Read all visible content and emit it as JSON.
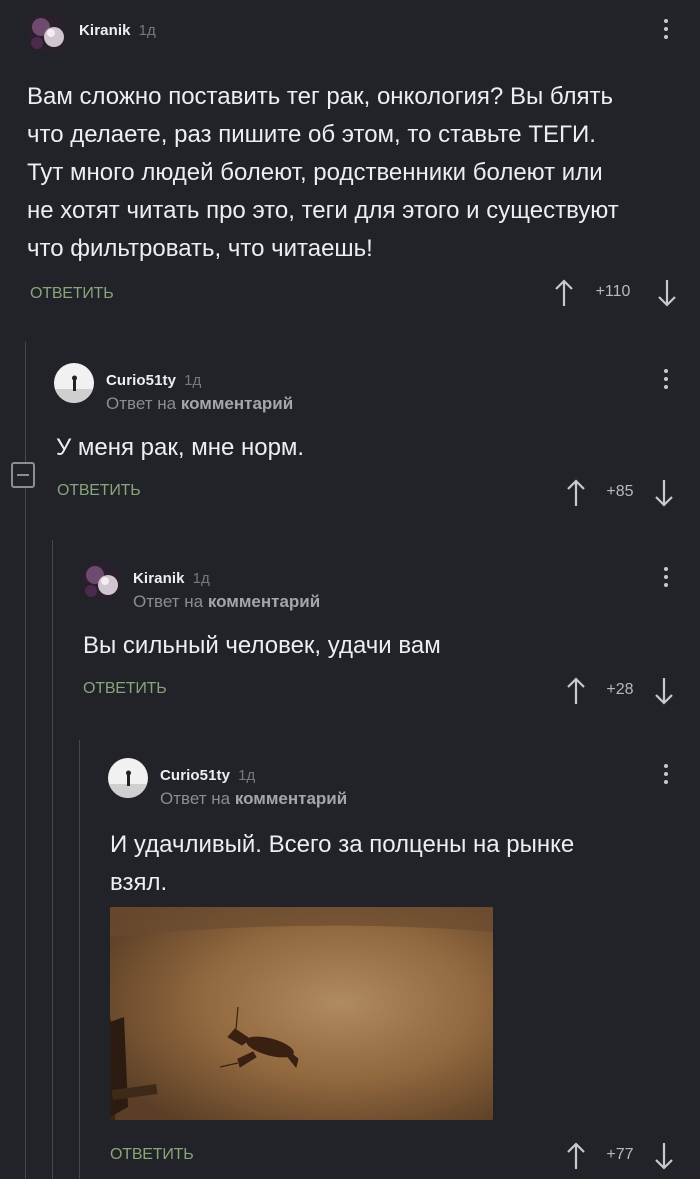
{
  "comments": [
    {
      "author": "Kiranik",
      "time": "1д",
      "text": "Вам сложно поставить тег рак, онкология? Вы блять что делаете, раз пишите об этом, то ставьте ТЕГИ. Тут много людей болеют, родственники болеют или не хотят читать про это, теги для этого и существуют что фильтровать, что читаешь!",
      "reply_label": "ОТВЕТИТЬ",
      "rating": "+110"
    },
    {
      "author": "Curio51ty",
      "time": "1д",
      "reply_to_prefix": "Ответ на",
      "reply_to_target": "комментарий",
      "text": "У меня рак, мне норм.",
      "reply_label": "ОТВЕТИТЬ",
      "rating": "+85"
    },
    {
      "author": "Kiranik",
      "time": "1д",
      "reply_to_prefix": "Ответ на",
      "reply_to_target": "комментарий",
      "text": "Вы сильный человек, удачи вам",
      "reply_label": "ОТВЕТИТЬ",
      "rating": "+28"
    },
    {
      "author": "Curio51ty",
      "time": "1д",
      "reply_to_prefix": "Ответ на",
      "reply_to_target": "комментарий",
      "text_line1": "И удачливый. Всего за полцены на рынке",
      "text_line2": "взял.",
      "image": "crayfish-in-bathtub-photo",
      "reply_label": "ОТВЕТИТЬ",
      "rating": "+77"
    }
  ],
  "icons": {
    "upvote": "arrow-up-icon",
    "downvote": "arrow-down-icon",
    "menu": "more-vertical-icon",
    "collapse": "collapse-thread-icon"
  },
  "colors": {
    "background": "#212328",
    "reply_link": "#8aa37a",
    "text": "#eceef0",
    "muted": "#8a8d92"
  }
}
